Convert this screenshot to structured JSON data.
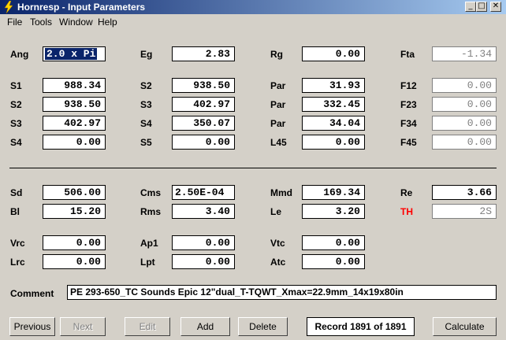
{
  "window": {
    "title": "Hornresp - Input Parameters",
    "minimize": "_",
    "maximize": "□",
    "close": "✕"
  },
  "menu": [
    "File",
    "Tools",
    "Window",
    "Help"
  ],
  "params": {
    "Ang": {
      "label": "Ang",
      "value": "2.0 x Pi"
    },
    "Eg": {
      "label": "Eg",
      "value": "2.83"
    },
    "Rg": {
      "label": "Rg",
      "value": "0.00"
    },
    "Fta": {
      "label": "Fta",
      "value": "-1.34"
    },
    "S1": {
      "label": "S1",
      "value": "988.34"
    },
    "S2a": {
      "label": "S2",
      "value": "938.50"
    },
    "Par1": {
      "label": "Par",
      "value": "31.93"
    },
    "F12": {
      "label": "F12",
      "value": "0.00"
    },
    "S2b": {
      "label": "S2",
      "value": "938.50"
    },
    "S3a": {
      "label": "S3",
      "value": "402.97"
    },
    "Par2": {
      "label": "Par",
      "value": "332.45"
    },
    "F23": {
      "label": "F23",
      "value": "0.00"
    },
    "S3b": {
      "label": "S3",
      "value": "402.97"
    },
    "S4a": {
      "label": "S4",
      "value": "350.07"
    },
    "Par3": {
      "label": "Par",
      "value": "34.04"
    },
    "F34": {
      "label": "F34",
      "value": "0.00"
    },
    "S4b": {
      "label": "S4",
      "value": "0.00"
    },
    "S5": {
      "label": "S5",
      "value": "0.00"
    },
    "L45": {
      "label": "L45",
      "value": "0.00"
    },
    "F45": {
      "label": "F45",
      "value": "0.00"
    },
    "Sd": {
      "label": "Sd",
      "value": "506.00"
    },
    "Cms": {
      "label": "Cms",
      "value": "2.50E-04"
    },
    "Mmd": {
      "label": "Mmd",
      "value": "169.34"
    },
    "Re": {
      "label": "Re",
      "value": "3.66"
    },
    "Bl": {
      "label": "Bl",
      "value": "15.20"
    },
    "Rms": {
      "label": "Rms",
      "value": "3.40"
    },
    "Le": {
      "label": "Le",
      "value": "3.20"
    },
    "TH": {
      "label": "TH",
      "value": "2S"
    },
    "Vrc": {
      "label": "Vrc",
      "value": "0.00"
    },
    "Ap1": {
      "label": "Ap1",
      "value": "0.00"
    },
    "Vtc": {
      "label": "Vtc",
      "value": "0.00"
    },
    "Lrc": {
      "label": "Lrc",
      "value": "0.00"
    },
    "Lpt": {
      "label": "Lpt",
      "value": "0.00"
    },
    "Atc": {
      "label": "Atc",
      "value": "0.00"
    }
  },
  "comment": {
    "label": "Comment",
    "value": "PE 293-650_TC Sounds Epic 12\"dual_T-TQWT_Xmax=22.9mm_14x19x80in"
  },
  "buttons": {
    "previous": "Previous",
    "next": "Next",
    "edit": "Edit",
    "add": "Add",
    "delete": "Delete",
    "calculate": "Calculate"
  },
  "record": "Record 1891 of 1891",
  "colors": {
    "title_start": "#0a246a",
    "title_end": "#a6caf0",
    "window_bg": "#d4d0c8",
    "th_label": "#ff0000",
    "disabled_text": "#808080"
  }
}
